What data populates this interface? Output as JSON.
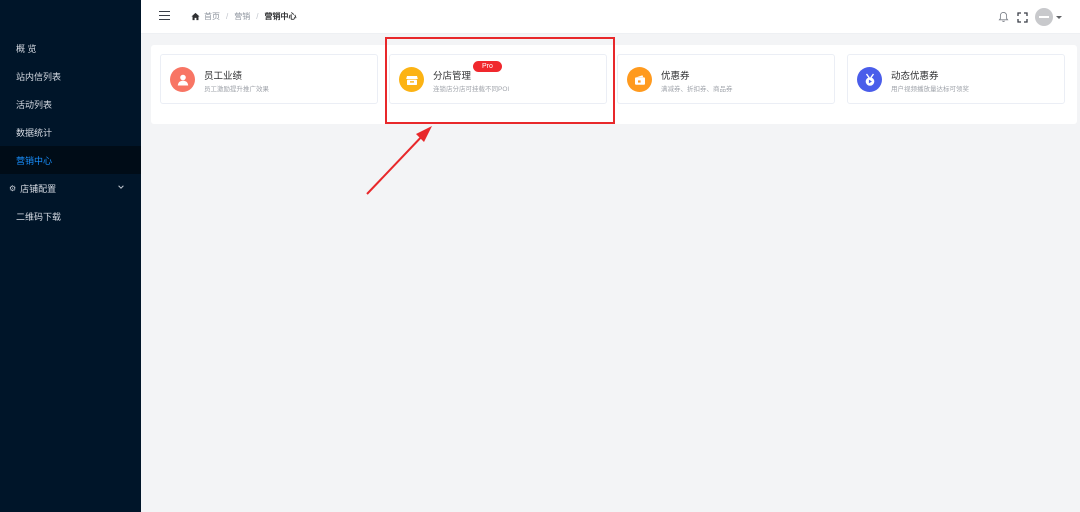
{
  "sidebar": {
    "items": [
      {
        "label": "概 览",
        "active": false
      },
      {
        "label": "站内信列表",
        "active": false
      },
      {
        "label": "活动列表",
        "active": false
      },
      {
        "label": "数据统计",
        "active": false
      },
      {
        "label": "营销中心",
        "active": true
      },
      {
        "label": "店铺配置",
        "active": false,
        "icon": "gear-icon",
        "expandable": true
      },
      {
        "label": "二维码下载",
        "active": false
      }
    ]
  },
  "header": {
    "breadcrumb": [
      "首页",
      "营销",
      "营销中心"
    ]
  },
  "cards": [
    {
      "title": "员工业绩",
      "desc": "员工激励提升推广效果",
      "icon": "user-icon",
      "color": "#f87564"
    },
    {
      "title": "分店管理",
      "desc": "连锁店分店可挂载不同POI",
      "icon": "store-icon",
      "color": "#fcb314",
      "badge": "Pro"
    },
    {
      "title": "优惠券",
      "desc": "满减券、折扣券、商品券",
      "icon": "wallet-icon",
      "color": "#ff9a1e"
    },
    {
      "title": "动态优惠券",
      "desc": "用户视频播放量达标可领奖",
      "icon": "medal-play-icon",
      "color": "#4a5dea"
    }
  ],
  "colors": {
    "sidebar_bg": "#001529",
    "active_text": "#1890ff",
    "pro_badge": "#f0282d",
    "annotation": "#e8282b"
  }
}
